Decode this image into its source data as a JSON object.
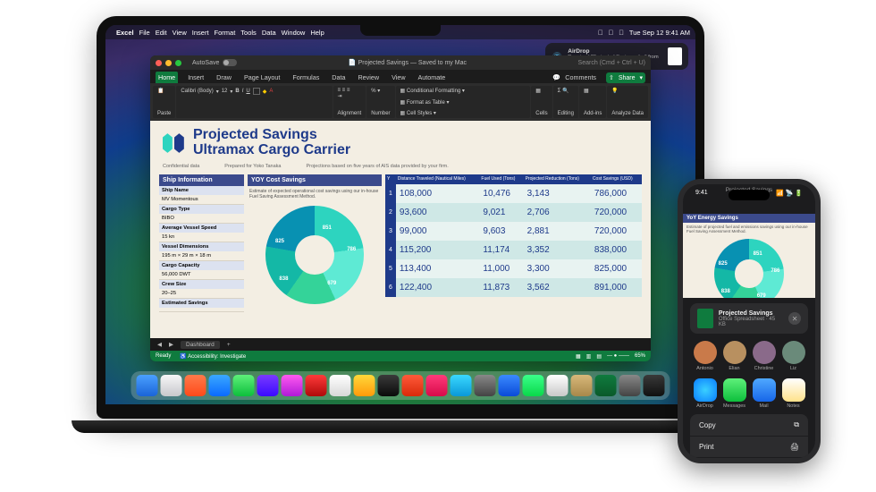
{
  "menubar": {
    "apple": "",
    "app": "Excel",
    "items": [
      "File",
      "Edit",
      "View",
      "Insert",
      "Format",
      "Tools",
      "Data",
      "Window",
      "Help"
    ],
    "datetime": "Tue Sep 12  9:41 AM"
  },
  "airdrop": {
    "title": "AirDrop",
    "body": "Received \"Projected Savings.xlsx\" from Leticia Ibarra."
  },
  "excel": {
    "autosave": "AutoSave",
    "filename": "Projected Savings — Saved to my Mac",
    "search_ph": "Search (Cmd + Ctrl + U)",
    "tabs": [
      "Home",
      "Insert",
      "Draw",
      "Page Layout",
      "Formulas",
      "Data",
      "Review",
      "View",
      "Automate"
    ],
    "comments": "Comments",
    "share": "Share",
    "ribbon": {
      "paste": "Paste",
      "font": "Calibri (Body)",
      "size": "12",
      "align": "Alignment",
      "num": "Number",
      "condfmt": "Conditional Formatting",
      "fmttable": "Format as Table",
      "cellstyles": "Cell Styles",
      "cells": "Cells",
      "editing": "Editing",
      "addins": "Add-ins",
      "analyze": "Analyze Data"
    },
    "sheet_tab": "Dashboard",
    "status_ready": "Ready",
    "status_acc": "Accessibility: Investigate",
    "zoom": "65%"
  },
  "doc": {
    "title1": "Projected Savings",
    "title2": "Ultramax Cargo Carrier",
    "meta": {
      "conf": "Confidential data",
      "prep": "Prepared for Yoko Tanaka",
      "proj": "Projections based on five years of AIS data provided by your firm."
    },
    "ship_header": "Ship Information",
    "ship_rows": [
      {
        "l": "Ship Name",
        "v": "MV Momentous"
      },
      {
        "l": "Cargo Type",
        "v": "BIBO"
      },
      {
        "l": "Average Vessel Speed",
        "v": "15 kn"
      },
      {
        "l": "Vessel Dimensions",
        "v": "195 m × 29 m × 18 m"
      },
      {
        "l": "Cargo Capacity",
        "v": "56,000 DWT"
      },
      {
        "l": "Crew Size",
        "v": "20–25"
      },
      {
        "l": "Estimated Savings",
        "v": ""
      }
    ],
    "yoy_header": "YOY Cost Savings",
    "yoy_desc": "Estimate of expected operational cost savings using our in-house Fuel Saving Assessment Method.",
    "pie": [
      "851",
      "786",
      "679",
      "838",
      "825"
    ],
    "table": {
      "cols": [
        "Y",
        "Distance Traveled (Nautical Miles)",
        "Fuel Used (Tons)",
        "Projected Reduction (Tons)",
        "Cost Savings (USD)"
      ],
      "rows": [
        [
          "1",
          "108,000",
          "10,476",
          "3,143",
          "786,000"
        ],
        [
          "2",
          "93,600",
          "9,021",
          "2,706",
          "720,000"
        ],
        [
          "3",
          "99,000",
          "9,603",
          "2,881",
          "720,000"
        ],
        [
          "4",
          "115,200",
          "11,174",
          "3,352",
          "838,000"
        ],
        [
          "5",
          "113,400",
          "11,000",
          "3,300",
          "825,000"
        ],
        [
          "6",
          "122,400",
          "11,873",
          "3,562",
          "891,000"
        ]
      ]
    }
  },
  "phone": {
    "time": "9:41",
    "title": "Projected Savings",
    "preview_header": "YoY Energy Savings",
    "preview_desc": "Estimate of projected fuel and emissions savings using our in-house Fuel Saving Assessment Method.",
    "card": {
      "name": "Projected Savings",
      "detail": "Office Spreadsheet · 45 KB"
    },
    "people": [
      {
        "n": "Antonio",
        "c": "#c97a4a"
      },
      {
        "n": "Elian",
        "c": "#b89060"
      },
      {
        "n": "Christine",
        "c": "#8a6a8a"
      },
      {
        "n": "Liz",
        "c": "#6a8a7a"
      }
    ],
    "apps": [
      {
        "n": "AirDrop",
        "c": "radial-gradient(circle,#3ad0ff,#0a7cff)"
      },
      {
        "n": "Messages",
        "c": "linear-gradient(#5ef07a,#0dbf3c)"
      },
      {
        "n": "Mail",
        "c": "linear-gradient(#4fa8ff,#1766e8)"
      },
      {
        "n": "Notes",
        "c": "linear-gradient(#fff,#ffe28a)"
      }
    ],
    "actions": [
      "Copy",
      "Print"
    ]
  },
  "dock_colors": [
    "linear-gradient(#4aa0ff,#1a64d8)",
    "linear-gradient(#f6f6f8,#c8c8cc)",
    "linear-gradient(#ff7a4a,#ff4a1a)",
    "linear-gradient(#3aa8ff,#0a6aff)",
    "linear-gradient(#5ef07a,#0dbf3c)",
    "linear-gradient(#7a3aff,#3a0aff)",
    "linear-gradient(#ff5af0,#b01ad8)",
    "linear-gradient(#ff3a3a,#b00a0a)",
    "linear-gradient(#fff,#d8d8d8)",
    "linear-gradient(#ffd83a,#ff9a0a)",
    "linear-gradient(#3a3a3a,#0a0a0a)",
    "linear-gradient(#ff5a3a,#d82a0a)",
    "linear-gradient(#ff3a7a,#d80a4a)",
    "linear-gradient(#3ad8ff,#0a98d8)",
    "linear-gradient(#888,#444)",
    "linear-gradient(#3a8aff,#0a4ad8)",
    "linear-gradient(#3aff8a,#0ad84a)",
    "linear-gradient(#fff,#c8c8c8)",
    "linear-gradient(#d8b87a,#a8884a)",
    "linear-gradient(#0f7b3e,#0a5a2a)",
    "linear-gradient(#888,#444)",
    "linear-gradient(#3a3a3a,#111)"
  ]
}
